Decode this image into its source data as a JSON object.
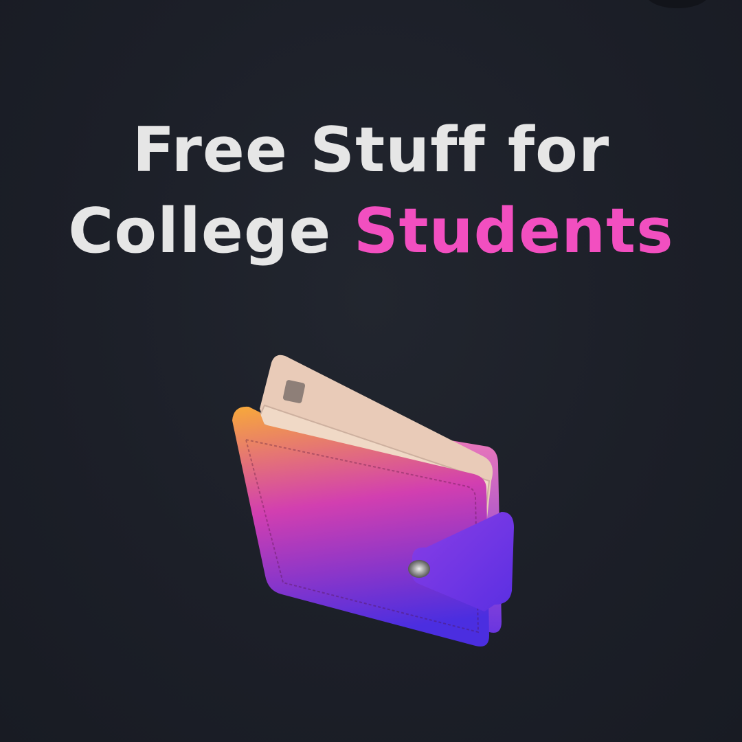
{
  "headline": {
    "line1": "Free Stuff for",
    "line2_plain": "College",
    "line2_accent": "Students"
  },
  "colors": {
    "background": "#1c1f28",
    "text": "#e6e6e6",
    "accent": "#f24fc0",
    "wallet_top": "#f7a93a",
    "wallet_mid": "#d23fb0",
    "wallet_bottom": "#4b2ee0"
  },
  "illustration": {
    "icon": "wallet-with-cards-icon"
  }
}
